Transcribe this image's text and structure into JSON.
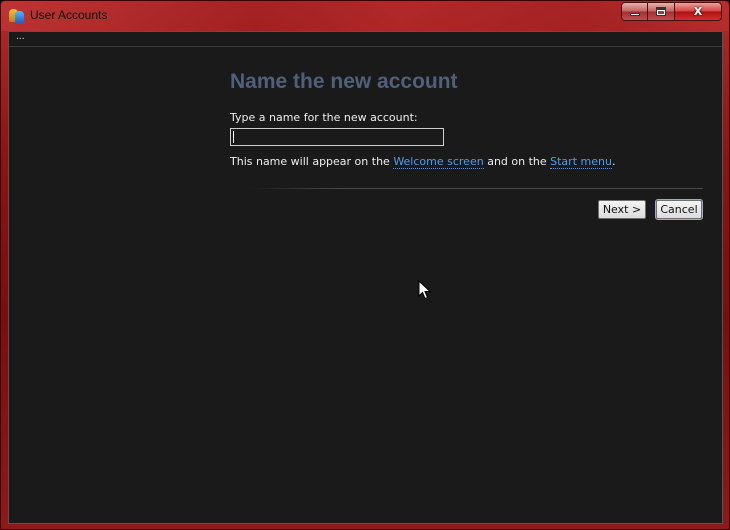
{
  "window": {
    "title": "User Accounts",
    "icon": "user-accounts-icon",
    "controls": {
      "minimize": "minimize-icon",
      "maximize": "maximize-icon",
      "close_glyph": "X"
    }
  },
  "menustrip": {
    "overflow_label": "..."
  },
  "page": {
    "heading": "Name the new account",
    "prompt": "Type a name for the new account:",
    "name_value": "",
    "info_prefix": "This name will appear on the ",
    "welcome_link": "Welcome screen",
    "info_middle": " and on the ",
    "start_link": "Start menu",
    "info_suffix": "."
  },
  "buttons": {
    "next": "Next >",
    "cancel": "Cancel"
  },
  "colors": {
    "frame": "#8a1414",
    "client_bg": "#1a1a1a",
    "heading": "#50607a",
    "link": "#4c9cf0"
  }
}
